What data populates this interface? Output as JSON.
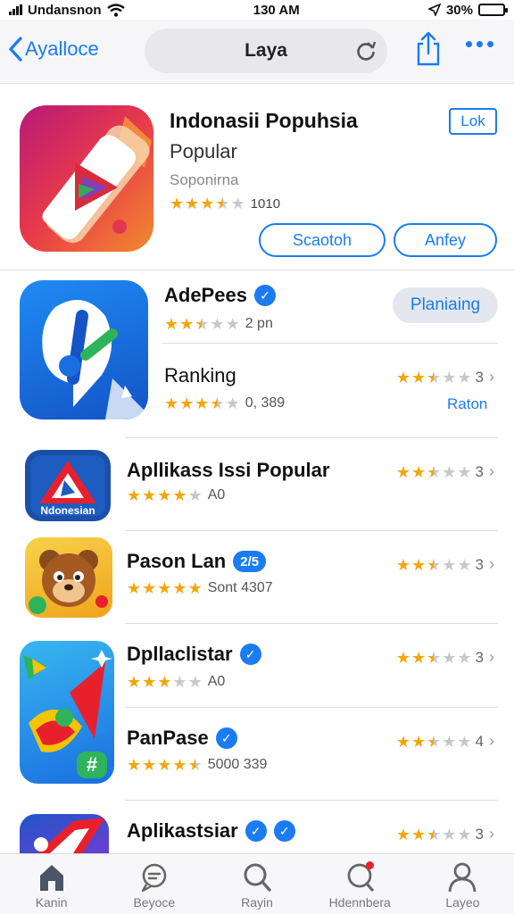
{
  "status_bar": {
    "carrier": "Undansnon",
    "time": "130 AM",
    "battery": "30%",
    "battery_level": 0.8
  },
  "nav": {
    "back_label": "Ayalloce",
    "search_text": "Laya",
    "icons": [
      "chevron-left-icon",
      "reload-icon",
      "share-icon",
      "more-icon"
    ]
  },
  "featured": {
    "title": "Indonasii Popuhsia",
    "subtitle": "Popular",
    "developer": "Soponirna",
    "stars": 3.5,
    "rating_count": "1010",
    "top_button": "Lok",
    "buttons": [
      "Scaotoh",
      "Anfey"
    ]
  },
  "block2": {
    "title": "AdePees",
    "rating_text": "2 pn",
    "stars": 2.5,
    "action": "Planiaing",
    "sub_title": "Ranking",
    "sub_rating_text": "0, 389",
    "sub_stars": 3.5,
    "right_stars": 2.5,
    "right_value": "3",
    "right_link": "Raton"
  },
  "apps": [
    {
      "title": "Apllikass Issi Popular",
      "icon_text": "Ndonesian",
      "stars": 4,
      "rating_text": "A0",
      "right_stars": 2.5,
      "right_value": "3"
    },
    {
      "title": "Pason Lan",
      "badge": "2/5",
      "stars": 5,
      "rating_text": "Sont 4307",
      "right_stars": 2.5,
      "right_value": "3"
    },
    {
      "title": "Dpllaclistar",
      "badge_icon": "verified-icon",
      "stars": 3,
      "rating_text": "A0",
      "right_stars": 2.5,
      "right_value": "3"
    },
    {
      "title": "PanPase",
      "badge_icon": "verified-icon",
      "stars": 4.5,
      "rating_text": "5000 339",
      "right_stars": 2.5,
      "right_value": "4"
    },
    {
      "title": "Aplikastsiar",
      "badge_icon": "verified-icon",
      "right_stars": 2.5,
      "right_value": "3"
    }
  ],
  "tabs": [
    {
      "label": "Kanin",
      "icon": "home-icon"
    },
    {
      "label": "Beyoce",
      "icon": "chat-icon"
    },
    {
      "label": "Rayin",
      "icon": "search-icon"
    },
    {
      "label": "Hdennbera",
      "icon": "notification-icon"
    },
    {
      "label": "Layeo",
      "icon": "profile-icon"
    }
  ],
  "colors": {
    "accent": "#1a7cf0",
    "star": "#f2a60c"
  }
}
